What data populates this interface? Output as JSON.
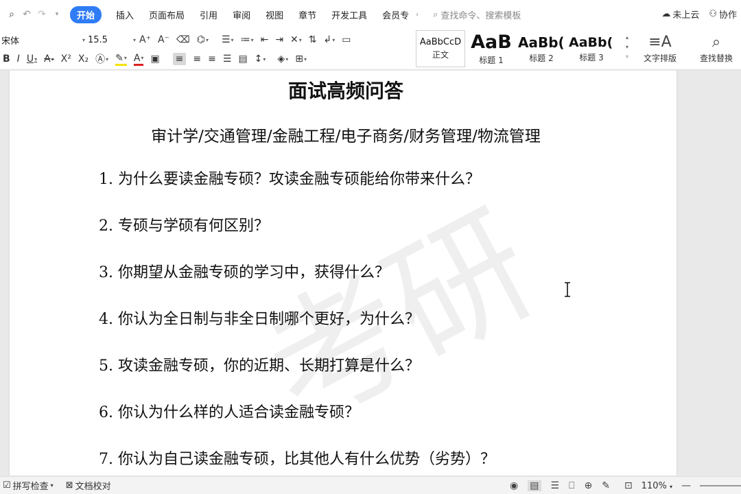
{
  "menubar": {
    "tabs": [
      "开始",
      "插入",
      "页面布局",
      "引用",
      "审阅",
      "视图",
      "章节",
      "开发工具",
      "会员专"
    ],
    "active_tab": "开始",
    "search_placeholder": "查找命令、搜索模板",
    "cloud_label": "未上云",
    "collab_label": "协作"
  },
  "toolbar": {
    "font_name": "宋体",
    "font_size": "15.5",
    "styles": [
      {
        "preview": "AaBbCcD",
        "name": "正文"
      },
      {
        "preview": "AaB",
        "name": "标题 1"
      },
      {
        "preview": "AaBb(",
        "name": "标题 2"
      },
      {
        "preview": "AaBb(",
        "name": "标题 3"
      }
    ],
    "text_layout_label": "文字排版",
    "find_replace_label": "查找替换"
  },
  "document": {
    "title": "面试高频问答",
    "subtitle": "审计学/交通管理/金融工程/电子商务/财务管理/物流管理",
    "questions": [
      "1. 为什么要读金融专硕？攻读金融专硕能给你带来什么？",
      "2. 专硕与学硕有何区别？",
      "3. 你期望从金融专硕的学习中，获得什么？",
      "4. 你认为全日制与非全日制哪个更好，为什么？",
      "5. 攻读金融专硕，你的近期、长期打算是什么？",
      "6. 你认为什么样的人适合读金融专硕？",
      "7. 你认为自己读金融专硕，比其他人有什么优势（劣势）？"
    ]
  },
  "statusbar": {
    "spell_check": "拼写检查",
    "doc_proof": "文档校对",
    "zoom": "110%"
  },
  "colors": {
    "accent": "#2f7cf6"
  }
}
